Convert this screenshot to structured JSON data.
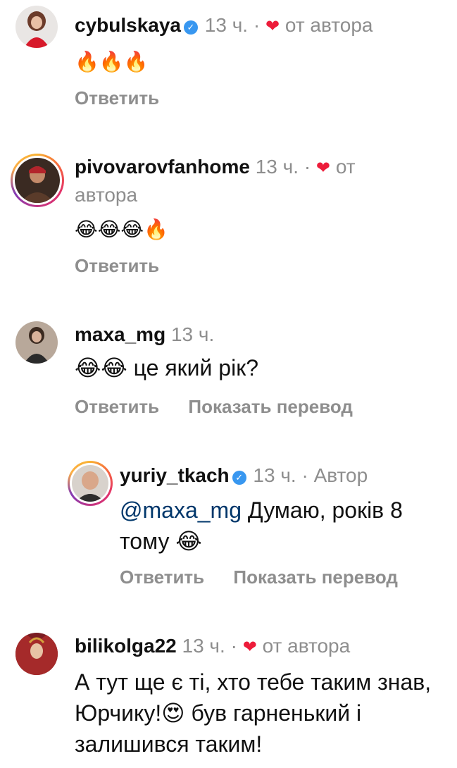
{
  "comments": [
    {
      "username": "cybulskaya",
      "verified": true,
      "time": "13 ч.",
      "separator": "·",
      "liked_label": "от автора",
      "text": "🔥🔥🔥",
      "reply_label": "Ответить"
    },
    {
      "username": "pivovarovfanhome",
      "verified": false,
      "time": "13 ч.",
      "separator": "·",
      "liked_label": "от автора",
      "text": "😂😂😂🔥",
      "reply_label": "Ответить"
    },
    {
      "username": "maxa_mg",
      "verified": false,
      "time": "13 ч.",
      "text": "😂😂 це який рік?",
      "reply_label": "Ответить",
      "translate_label": "Показать перевод"
    },
    {
      "username": "yuriy_tkach",
      "verified": true,
      "time": "13 ч.",
      "separator": "·",
      "author_label": "Автор",
      "mention": "@maxa_mg",
      "text": "Думаю, років 8 тому 😂",
      "reply_label": "Ответить",
      "translate_label": "Показать перевод"
    },
    {
      "username": "bilikolga22",
      "verified": false,
      "time": "13 ч.",
      "separator": "·",
      "liked_label": "от автора",
      "text": "А тут ще є ті, хто тебе таким знав, Юрчику!😍 був гарненький і залишився таким!"
    }
  ],
  "colors": {
    "muted": "#8e8e8e",
    "heart": "#ed1c3a",
    "verified": "#3897f0",
    "mention": "#00376b"
  },
  "icons": [
    "verified-badge-icon",
    "heart-icon"
  ]
}
